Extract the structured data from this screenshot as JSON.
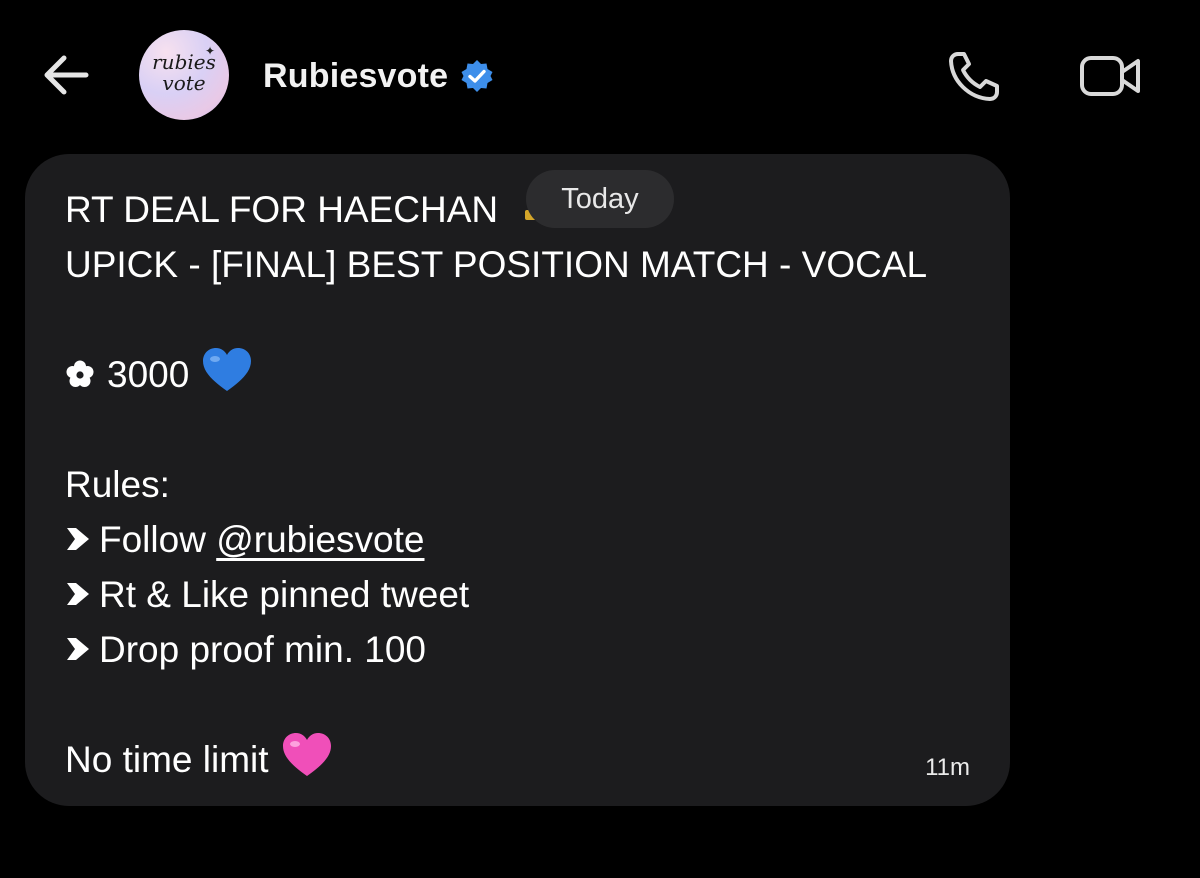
{
  "header": {
    "contact_name": "Rubiesvote",
    "avatar_text": "rubies\nvote"
  },
  "today_label": "Today",
  "message": {
    "title_line": "RT DEAL FOR HAECHAN",
    "subtitle_line": "UPICK - [FINAL] BEST POSITION MATCH - VOCAL",
    "reward_amount": "3000",
    "rules_heading": "Rules:",
    "rules": [
      {
        "prefix": "Follow ",
        "mention": "@rubiesvote"
      },
      {
        "prefix": "Rt & Like pinned tweet"
      },
      {
        "prefix": "Drop proof min. 100"
      }
    ],
    "closing": "No time limit",
    "timestamp": "11m"
  },
  "colors": {
    "background": "#000000",
    "bubble": "#1c1c1e",
    "pill": "#2c2c2e",
    "verified_badge": "#3d8eea",
    "blue_heart": "#2f7de1",
    "pink_heart": "#f04fb9"
  },
  "icons": {
    "back": "arrow-left-icon",
    "verified": "verified-badge-icon",
    "call": "phone-icon",
    "video": "video-camera-icon",
    "flower": "flower-icon",
    "bullet": "arrow-bullet-icon",
    "blue_heart": "blue-heart-icon",
    "pink_heart": "pink-heart-icon"
  }
}
